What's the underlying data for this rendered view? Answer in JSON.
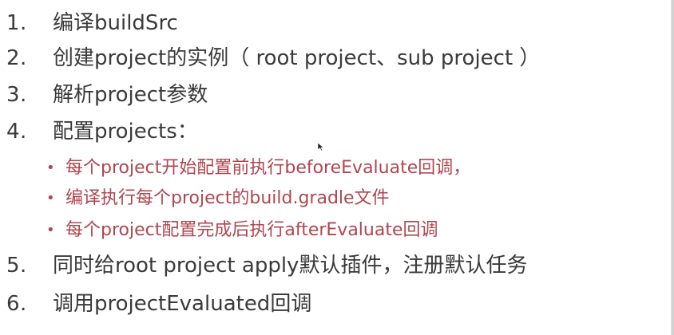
{
  "items": [
    {
      "num": "1.",
      "text": "编译buildSrc"
    },
    {
      "num": "2.",
      "text": "创建project的实例（ root project、sub project ）"
    },
    {
      "num": "3.",
      "text": "解析project参数"
    },
    {
      "num": "4.",
      "text": "配置projects："
    },
    {
      "num": "5.",
      "text": "同时给root project apply默认插件，注册默认任务"
    },
    {
      "num": "6.",
      "text": "调用projectEvaluated回调"
    }
  ],
  "sub_items": [
    {
      "bullet": "•",
      "text": "每个project开始配置前执行beforeEvaluate回调，"
    },
    {
      "bullet": "•",
      "text": "编译执行每个project的build.gradle文件"
    },
    {
      "bullet": "•",
      "text": "每个project配置完成后执行afterEvaluate回调"
    }
  ],
  "colors": {
    "main_text": "#3a3a3a",
    "sub_text": "#b0464e",
    "background": "#ffffff"
  },
  "icons": {
    "cursor": "mouse-pointer-icon"
  }
}
